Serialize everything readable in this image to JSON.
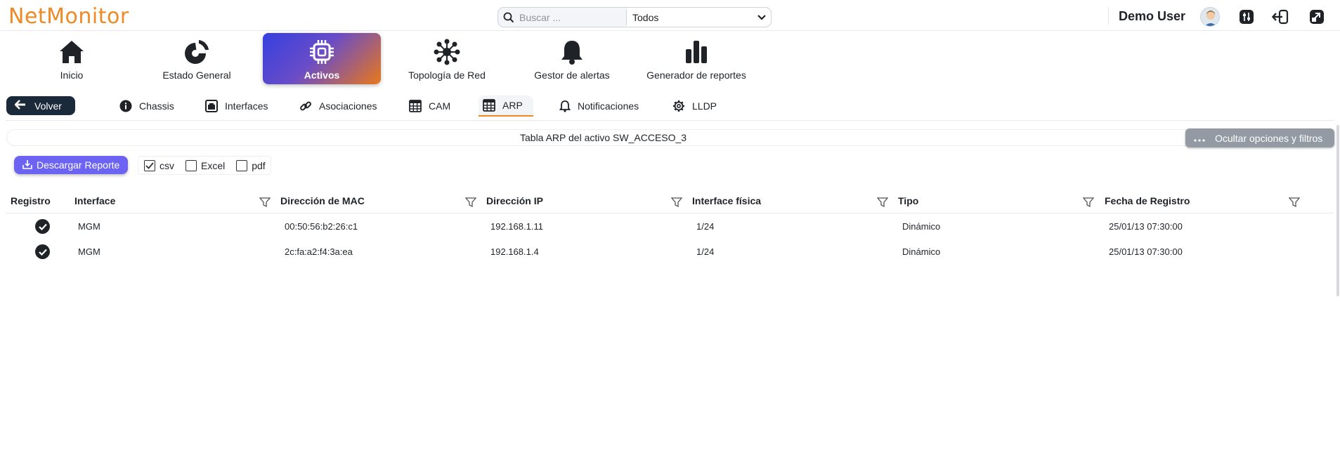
{
  "app": {
    "logo": "NetMonitor"
  },
  "search": {
    "placeholder": "Buscar ...",
    "scope": "Todos"
  },
  "user": {
    "name": "Demo User"
  },
  "modules": [
    {
      "label": "Inicio",
      "icon": "home-icon"
    },
    {
      "label": "Estado General",
      "icon": "pie-chart-icon"
    },
    {
      "label": "Activos",
      "icon": "chip-icon",
      "active": true
    },
    {
      "label": "Topología de Red",
      "icon": "network-icon"
    },
    {
      "label": "Gestor de alertas",
      "icon": "bell-icon"
    },
    {
      "label": "Generador de reportes",
      "icon": "bar-chart-icon"
    }
  ],
  "back": {
    "label": "Volver"
  },
  "tabs": [
    {
      "label": "Chassis",
      "icon": "info-icon"
    },
    {
      "label": "Interfaces",
      "icon": "interface-icon"
    },
    {
      "label": "Asociaciones",
      "icon": "link-icon"
    },
    {
      "label": "CAM",
      "icon": "table-icon"
    },
    {
      "label": "ARP",
      "icon": "table-icon",
      "active": true
    },
    {
      "label": "Notificaciones",
      "icon": "bell-icon"
    },
    {
      "label": "LLDP",
      "icon": "gear-icon"
    }
  ],
  "table_title": "Tabla ARP del activo SW_ACCESO_3",
  "hide_options": {
    "label": "Ocultar opciones y filtros"
  },
  "export": {
    "download_label": "Descargar Reporte",
    "formats": [
      {
        "label": "csv",
        "checked": true
      },
      {
        "label": "Excel",
        "checked": false
      },
      {
        "label": "pdf",
        "checked": false
      }
    ]
  },
  "table": {
    "columns": [
      "Registro",
      "Interface",
      "Dirección de MAC",
      "Dirección IP",
      "Interface física",
      "Tipo",
      "Fecha de Registro"
    ],
    "rows": [
      {
        "registered": true,
        "interface": "MGM",
        "mac": "00:50:56:b2:26:c1",
        "ip": "192.168.1.11",
        "physical": "1/24",
        "type": "Dinámico",
        "date": "25/01/13 07:30:00"
      },
      {
        "registered": true,
        "interface": "MGM",
        "mac": "2c:fa:a2:f4:3a:ea",
        "ip": "192.168.1.4",
        "physical": "1/24",
        "type": "Dinámico",
        "date": "25/01/13 07:30:00"
      }
    ]
  },
  "colors": {
    "brand": "#ee8a25",
    "primary": "#6c63f2",
    "dark": "#1b2a3b"
  }
}
